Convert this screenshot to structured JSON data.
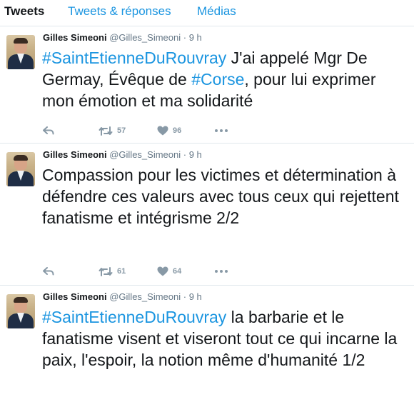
{
  "tabs": [
    {
      "label": "Tweets",
      "active": true
    },
    {
      "label": "Tweets & réponses",
      "active": false
    },
    {
      "label": "Médias",
      "active": false
    }
  ],
  "tweets": [
    {
      "name": "Gilles Simeoni",
      "handle": "@Gilles_Simeoni",
      "time": "· 9 h",
      "segments": [
        {
          "t": "#SaintEtienneDuRouvray",
          "tag": true
        },
        {
          "t": " J'ai appelé Mgr De Germay, Évêque de ",
          "tag": false
        },
        {
          "t": "#Corse",
          "tag": true
        },
        {
          "t": ", pour lui exprimer mon émotion et ma solidarité",
          "tag": false
        }
      ],
      "retweets": "57",
      "likes": "96"
    },
    {
      "name": "Gilles Simeoni",
      "handle": "@Gilles_Simeoni",
      "time": "· 9 h",
      "segments": [
        {
          "t": "Compassion pour les victimes et détermination à défendre ces valeurs avec tous ceux qui rejettent fanatisme et intégrisme 2/2",
          "tag": false
        }
      ],
      "retweets": "61",
      "likes": "64"
    },
    {
      "name": "Gilles Simeoni",
      "handle": "@Gilles_Simeoni",
      "time": "· 9 h",
      "segments": [
        {
          "t": "#SaintEtienneDuRouvray",
          "tag": true
        },
        {
          "t": " la barbarie et le fanatisme visent et viseront tout ce qui incarne la paix, l'espoir, la notion même d'humanité 1/2",
          "tag": false
        }
      ],
      "retweets": "",
      "likes": ""
    }
  ],
  "colors": {
    "link": "#1b95e0",
    "text": "#14171a",
    "muted": "#657786",
    "icon": "#8899a6"
  },
  "icons": [
    "reply-icon",
    "retweet-icon",
    "heart-icon",
    "more-icon"
  ]
}
